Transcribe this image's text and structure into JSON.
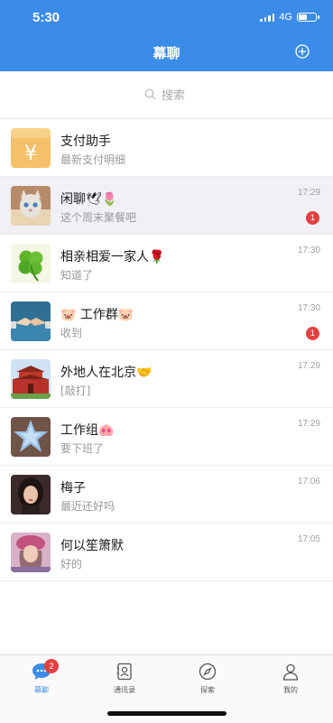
{
  "status": {
    "time": "5:30",
    "network": "4G",
    "battery_level": 0.55
  },
  "header": {
    "title": "幕聊"
  },
  "search": {
    "placeholder": "搜索"
  },
  "chats": [
    {
      "name": "支付助手",
      "preview": "最新支付明细",
      "time": "",
      "badge": "",
      "avatar": "payment-yen-icon"
    },
    {
      "name": "闲聊🕊🌷",
      "preview": "这个周末聚餐吧",
      "time": "17:29",
      "badge": "1",
      "avatar": "cat-photo"
    },
    {
      "name": "相亲相爱一家人🌹",
      "preview": "知道了",
      "time": "17:30",
      "badge": "",
      "avatar": "clover-photo"
    },
    {
      "name": "🐷 工作群🐷",
      "preview": "收到",
      "time": "17:30",
      "badge": "1",
      "avatar": "handshake-photo"
    },
    {
      "name": "外地人在北京🤝",
      "preview": "[敲打]",
      "time": "17:29",
      "badge": "",
      "avatar": "tiananmen-photo"
    },
    {
      "name": "工作组🐽",
      "preview": "要下班了",
      "time": "17:29",
      "badge": "",
      "avatar": "star-hands-photo"
    },
    {
      "name": "梅子",
      "preview": "最近还好吗",
      "time": "17:06",
      "badge": "",
      "avatar": "woman-photo"
    },
    {
      "name": "何以笙箫默",
      "preview": "好的",
      "time": "17:05",
      "badge": "",
      "avatar": "girl-hat-photo"
    }
  ],
  "tabs": [
    {
      "label": "幕聊",
      "icon": "chat-bubble-icon",
      "badge": "2",
      "active": true
    },
    {
      "label": "通讯录",
      "icon": "contacts-icon",
      "badge": "",
      "active": false
    },
    {
      "label": "探索",
      "icon": "compass-icon",
      "badge": "",
      "active": false
    },
    {
      "label": "我的",
      "icon": "person-icon",
      "badge": "",
      "active": false
    }
  ],
  "colors": {
    "primary": "#3b8ce8",
    "badge": "#e24040",
    "payment": "#f5c06a"
  }
}
